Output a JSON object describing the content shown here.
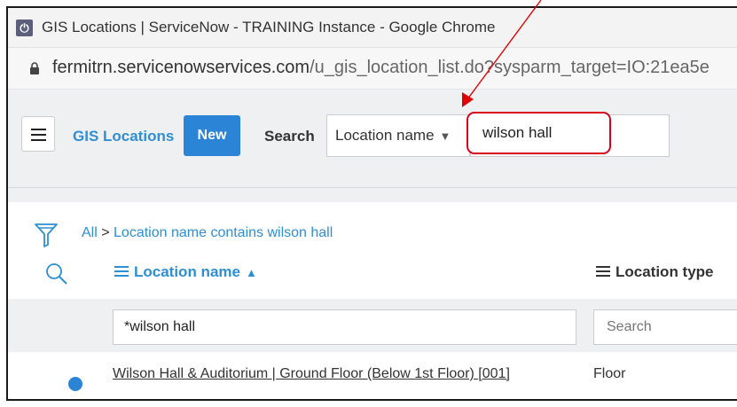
{
  "browser": {
    "window_title": "GIS Locations | ServiceNow - TRAINING Instance - Google Chrome",
    "url_host": "fermitrn.servicenowservices.com",
    "url_path": "/u_gis_location_list.do?sysparm_target=IO:21ea5e"
  },
  "list": {
    "title": "GIS Locations",
    "new_label": "New",
    "search_label": "Search",
    "search_field": "Location name",
    "search_value": "wilson hall"
  },
  "breadcrumb": {
    "all": "All",
    "separator": ">",
    "condition": "Location name contains wilson hall"
  },
  "columns": {
    "name": "Location name",
    "type": "Location type"
  },
  "filters": {
    "name_value": "*wilson hall",
    "type_placeholder": "Search"
  },
  "rows": [
    {
      "name": "Wilson Hall & Auditorium | Ground Floor (Below 1st Floor) [001]",
      "type": "Floor"
    }
  ],
  "colors": {
    "accent": "#2b84d6",
    "link": "#2e8fd3",
    "highlight": "#d9001b"
  }
}
